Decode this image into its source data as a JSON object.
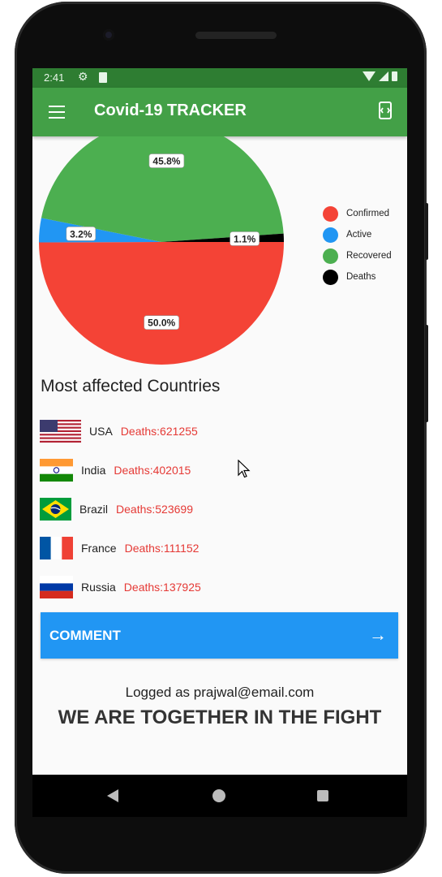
{
  "status_bar": {
    "time": "2:41"
  },
  "app_bar": {
    "title": "Covid-19 TRACKER"
  },
  "chart_data": {
    "type": "pie",
    "slices": [
      {
        "label": "Confirmed",
        "value": 50.0,
        "color": "#f44336"
      },
      {
        "label": "Active",
        "value": 3.2,
        "color": "#2196f3"
      },
      {
        "label": "Recovered",
        "value": 45.8,
        "color": "#4caf50"
      },
      {
        "label": "Deaths",
        "value": 1.1,
        "color": "#000000"
      }
    ],
    "data_labels": [
      "50.0%",
      "3.2%",
      "45.8%",
      "1.1%"
    ],
    "legend": [
      "Confirmed",
      "Active",
      "Recovered",
      "Deaths"
    ],
    "legend_position": "right"
  },
  "section": {
    "title": "Most affected Countries"
  },
  "countries": [
    {
      "name": "USA",
      "deaths": "Deaths:621255"
    },
    {
      "name": "India",
      "deaths": "Deaths:402015"
    },
    {
      "name": "Brazil",
      "deaths": "Deaths:523699"
    },
    {
      "name": "France",
      "deaths": "Deaths:111152"
    },
    {
      "name": "Russia",
      "deaths": "Deaths:137925"
    }
  ],
  "comment_button": {
    "label": "COMMENT"
  },
  "footer": {
    "logged_as": "Logged as prajwal@email.com",
    "slogan": "WE ARE TOGETHER IN THE FIGHT"
  },
  "colors": {
    "status_bar": "#2e7d32",
    "app_bar": "#43a047",
    "accent_button": "#2196f3",
    "deaths_text": "#e53935"
  }
}
